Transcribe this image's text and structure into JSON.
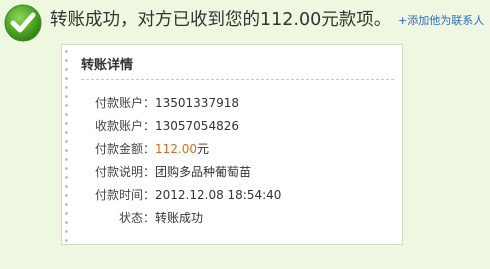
{
  "banner": {
    "headline": "转账成功，对方已收到您的112.00元款项。",
    "add_contact": "+添加他为联系人"
  },
  "details": {
    "title": "转账详情",
    "rows": [
      {
        "label": "付款账户：",
        "value": "13501337918"
      },
      {
        "label": "收款账户：",
        "value": "13057054826"
      },
      {
        "label": "付款金额：",
        "amount": "112.00",
        "unit": "元"
      },
      {
        "label": "付款说明：",
        "value": "团购多品种葡萄苗"
      },
      {
        "label": "付款时间：",
        "value": "2012.12.08 18:54:40"
      },
      {
        "label": "状态：",
        "value": "转账成功"
      }
    ]
  },
  "colors": {
    "background": "#eef7e0",
    "success_green": "#4aa51f",
    "amount_orange": "#e06c1a",
    "link_blue": "#2b6ec9"
  },
  "icons": [
    "success-check-icon"
  ]
}
